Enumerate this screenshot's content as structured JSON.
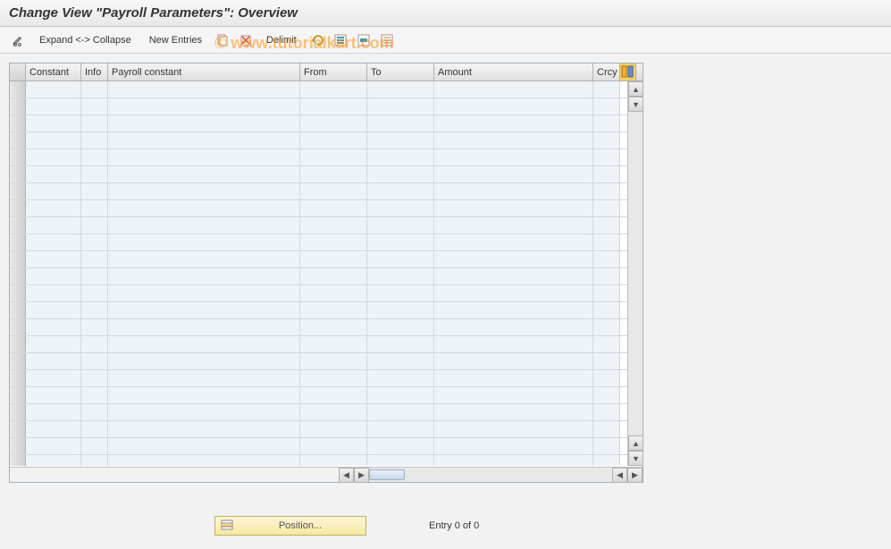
{
  "title": "Change View \"Payroll Parameters\": Overview",
  "watermark": "© www.tutorialkart.com",
  "toolbar": {
    "expand_collapse": "Expand <-> Collapse",
    "new_entries": "New Entries",
    "delimit": "Delimit"
  },
  "columns": {
    "constant": "Constant",
    "info": "Info",
    "payroll_constant": "Payroll constant",
    "from": "From",
    "to": "To",
    "amount": "Amount",
    "crcy": "Crcy"
  },
  "footer": {
    "position": "Position...",
    "entry_status": "Entry 0 of 0"
  }
}
